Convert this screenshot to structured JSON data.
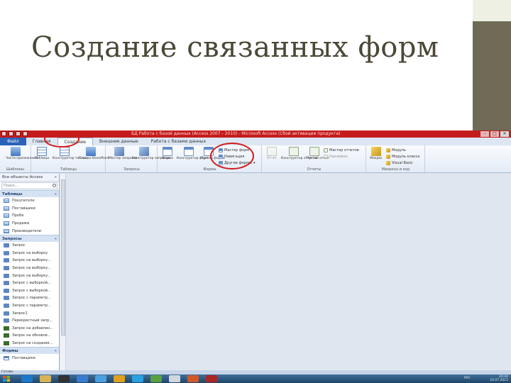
{
  "slide": {
    "title": "Создание связанных форм"
  },
  "window": {
    "title": "БД Работа с базой данных (Access 2007 - 2010) - Microsoft Access (Сбой активации продукта)",
    "controls": [
      "–",
      "□",
      "✕"
    ]
  },
  "tabs": [
    "Файл",
    "Главная",
    "Создание",
    "Внешние данные",
    "Работа с базами данных"
  ],
  "ribbon": {
    "templates": {
      "label": "Шаблоны",
      "btn": "Части приложения"
    },
    "tables": {
      "label": "Таблицы",
      "btns": [
        "Таблица",
        "Конструктор таблиц",
        "Списки SharePoint"
      ]
    },
    "queries": {
      "label": "Запросы",
      "btns": [
        "Мастер запросов",
        "Конструктор запросов"
      ]
    },
    "forms": {
      "label": "Формы",
      "btns": [
        "Форма",
        "Конструктор форм",
        "Пустая форма"
      ],
      "small": [
        "Мастер форм",
        "Навигация",
        "Другие формы"
      ]
    },
    "reports": {
      "label": "Отчеты",
      "btns": [
        "Отчет",
        "Конструктор отчетов",
        "Пустой отчет"
      ],
      "small": [
        "Мастер отчетов",
        "Наклейки"
      ]
    },
    "macros": {
      "label": "Макросы и код",
      "btn": "Макрос",
      "small": [
        "Модуль",
        "Модуль класса",
        "Visual Basic"
      ]
    }
  },
  "nav": {
    "header": "Все объекты Access",
    "header_chevron": "«",
    "search_placeholder": "Поиск...",
    "sections": [
      {
        "title": "Таблицы",
        "chevron": "«",
        "items": [
          "Покупатели",
          "Поставщики",
          "Проба",
          "Продажи",
          "Производители"
        ]
      },
      {
        "title": "Запросы",
        "chevron": "«",
        "items": [
          "Запрос",
          "Запрос на выборку",
          "Запрос на выборку...",
          "Запрос на выборку...",
          "Запрос на выборку...",
          "Запрос с выборкой...",
          "Запрос с выборкой...",
          "Запрос с параметр...",
          "Запрос с параметр...",
          "Запрос1",
          "Перекрестный запр...",
          "Запрос на добавлен...",
          "Запрос на обновле...",
          "Запрос на создание..."
        ]
      },
      {
        "title": "Формы",
        "chevron": "«",
        "items": [
          "Поставщики"
        ]
      }
    ]
  },
  "status": "Готово",
  "taskbar": {
    "lang": "РУС",
    "time": "20:44",
    "date": "24.07.2015"
  },
  "colors": {
    "title_bar": "#c41c1c",
    "highlight_circle": "#d01a1a",
    "file_tab": "#2a62b8",
    "slide_title": "#4b4838",
    "right_strip": "#6e6a55"
  }
}
